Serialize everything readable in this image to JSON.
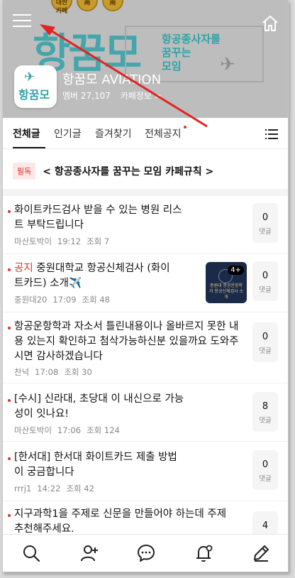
{
  "header": {
    "banner_title": "항꿈모",
    "slogan_line1": "항공종사자를",
    "slogan_line2": "꿈꾸는",
    "slogan_line3": "모임",
    "coins": [
      "대한 카페",
      "南",
      "南"
    ],
    "logo_text": "항꿈모",
    "cafe_name": "항꿈모 AVIATION",
    "members": "멤버 27,107",
    "cafe_info": "카페정보 >"
  },
  "tabs": [
    {
      "label": "전체글",
      "active": true
    },
    {
      "label": "인기글",
      "active": false
    },
    {
      "label": "즐겨찾기",
      "active": false
    },
    {
      "label": "전체공지",
      "active": false
    }
  ],
  "notice": {
    "badge": "필독",
    "text": "< 항공종사자를 꿈꾸는 모임 카페규칙 >"
  },
  "posts": [
    {
      "tag": "",
      "title": "화이트카드검사 받을 수 있는 병원 리스트 부탁드립니다",
      "author": "마산토박이",
      "time": "19:12",
      "views": "조회 7",
      "comments": "0",
      "comment_label": "댓글"
    },
    {
      "tag": "공지",
      "title": "중원대학교 항공신체검사 (화이트카드) 소개✈️",
      "author": "중원대20",
      "time": "17:09",
      "views": "조회 48",
      "comments": "0",
      "comment_label": "댓글",
      "thumb_badge": "4+",
      "thumb_text": "중원대 항공운항학과 항공신체검사 소개"
    },
    {
      "tag": "",
      "title": "항공운항학과 자소서 틀린내용이나 올바르지 못한 내용 있는지 확인하고 첨삭가능하신분 있을까요 도와주시면 감사하겠습니다",
      "author": "찬넉",
      "time": "17:08",
      "views": "조회 30",
      "comments": "0",
      "comment_label": "댓글"
    },
    {
      "tag": "",
      "title": "[수시] 신라대, 초당대 이 내신으로 가능성이 잇나요!",
      "author": "마산토박이",
      "time": "17:06",
      "views": "조회 124",
      "comments": "8",
      "comment_label": "댓글"
    },
    {
      "tag": "",
      "title": "[한서대] 한서대 화이트카드 제출 방법이 궁금합니다",
      "author": "rrrj1",
      "time": "14:22",
      "views": "조회 42",
      "comments": "0",
      "comment_label": "댓글"
    },
    {
      "tag": "",
      "title": "지구과학1을 주제로 신문을 만들어야 하는데 주제 추천해주세요.",
      "author": "",
      "time": "",
      "views": "",
      "comments": "4",
      "comment_label": "댓글"
    }
  ],
  "icons": {
    "menu": "hamburger-icon",
    "home": "home-icon",
    "more": "list-menu-icon",
    "search": "search-icon",
    "members": "add-user-icon",
    "chat": "chat-icon",
    "notifications": "bell-settings-icon",
    "write": "pencil-icon"
  },
  "colors": {
    "accent": "#2fa3a8",
    "red": "#e0322b"
  }
}
